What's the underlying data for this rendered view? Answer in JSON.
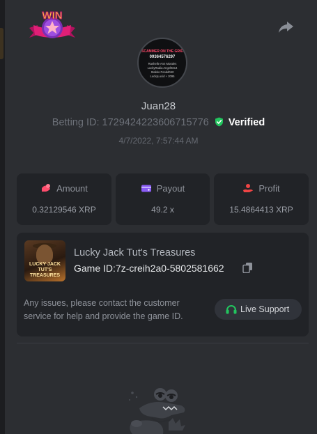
{
  "header": {
    "win_badge_text": "WIN",
    "share_icon": "share-arrow-icon"
  },
  "avatar": {
    "line1": "SCAMMER ON THE GRID",
    "line2": "09364576297",
    "line3": "Rashelle Ann Morales",
    "line4": "LuckyRadia Angel9214",
    "line5": "Stakko Foodd040",
    "line6": "LuckyLucid + 2095"
  },
  "user": {
    "username": "Juan28",
    "betting_id_label": "Betting ID:",
    "betting_id": "1729424223606715776",
    "verified_label": "Verified",
    "timestamp": "4/7/2022, 7:57:44 AM"
  },
  "stats": {
    "amount_label": "Amount",
    "amount_value": "0.32129546 XRP",
    "payout_label": "Payout",
    "payout_value": "49.2 x",
    "profit_label": "Profit",
    "profit_value": "15.4864413 XRP"
  },
  "game": {
    "thumbnail_text": "LUCKY JACK TUT'S TREASURES",
    "title": "Lucky Jack Tut's Treasures",
    "game_id_label": "Game ID:",
    "game_id": "7z-creih2a0-5802581662",
    "support_text": "Any issues, please contact the customer service for help and provide the game ID.",
    "live_support_label": "Live Support"
  },
  "colors": {
    "background": "#2c2e32",
    "card": "#212327",
    "verified_green": "#22c55e",
    "amount_icon": "#ff4d6d",
    "payout_icon": "#8b5cf6",
    "profit_icon": "#ef4444",
    "support_icon": "#22c55e"
  }
}
